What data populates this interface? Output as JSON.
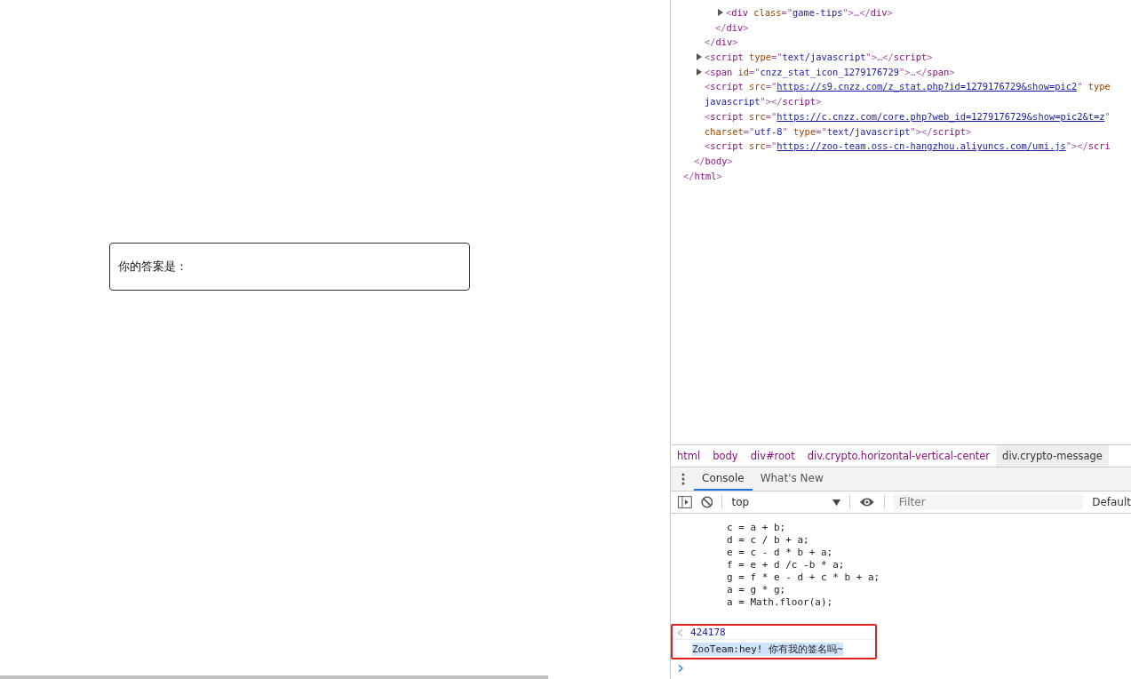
{
  "page": {
    "answer_label": "你的答案是："
  },
  "elements": {
    "tree": [
      {
        "children": [
          {
            "children": [
              {
                "children": [
                  {
                    "children": [
                      {
                        "arrow": true,
                        "lines": [
                          [
                            {
                              "kind": "punct",
                              "s": "<"
                            },
                            {
                              "kind": "tag",
                              "s": "div "
                            },
                            {
                              "kind": "attr",
                              "s": "class"
                            },
                            {
                              "kind": "punct",
                              "s": "=\""
                            },
                            {
                              "kind": "value",
                              "s": "game-tips"
                            },
                            {
                              "kind": "punct",
                              "s": "\">…</"
                            },
                            {
                              "kind": "tag",
                              "s": "div"
                            },
                            {
                              "kind": "punct",
                              "s": ">"
                            }
                          ]
                        ]
                      }
                    ],
                    "close": [
                      {
                        "kind": "punct",
                        "s": "</"
                      },
                      {
                        "kind": "tag",
                        "s": "div"
                      },
                      {
                        "kind": "punct",
                        "s": ">"
                      }
                    ]
                  }
                ],
                "close": [
                  {
                    "kind": "punct",
                    "s": "</"
                  },
                  {
                    "kind": "tag",
                    "s": "div"
                  },
                  {
                    "kind": "punct",
                    "s": ">"
                  }
                ]
              },
              {
                "arrow": true,
                "lines": [
                  [
                    {
                      "kind": "punct",
                      "s": "<"
                    },
                    {
                      "kind": "tag",
                      "s": "script "
                    },
                    {
                      "kind": "attr",
                      "s": "type"
                    },
                    {
                      "kind": "punct",
                      "s": "=\""
                    },
                    {
                      "kind": "value",
                      "s": "text/javascript"
                    },
                    {
                      "kind": "punct",
                      "s": "\">…</"
                    },
                    {
                      "kind": "tag",
                      "s": "script"
                    },
                    {
                      "kind": "punct",
                      "s": ">"
                    }
                  ]
                ]
              },
              {
                "arrow": true,
                "lines": [
                  [
                    {
                      "kind": "punct",
                      "s": "<"
                    },
                    {
                      "kind": "tag",
                      "s": "span "
                    },
                    {
                      "kind": "attr",
                      "s": "id"
                    },
                    {
                      "kind": "punct",
                      "s": "=\""
                    },
                    {
                      "kind": "value",
                      "s": "cnzz_stat_icon_1279176729"
                    },
                    {
                      "kind": "punct",
                      "s": "\">…</"
                    },
                    {
                      "kind": "tag",
                      "s": "span"
                    },
                    {
                      "kind": "punct",
                      "s": ">"
                    }
                  ]
                ]
              },
              {
                "arrow": false,
                "lines": [
                  [
                    {
                      "kind": "punct",
                      "s": "<"
                    },
                    {
                      "kind": "tag",
                      "s": "script "
                    },
                    {
                      "kind": "attr",
                      "s": "src"
                    },
                    {
                      "kind": "punct",
                      "s": "=\""
                    },
                    {
                      "kind": "link",
                      "s": "https://s9.cnzz.com/z_stat.php?id=1279176729&show=pic2"
                    },
                    {
                      "kind": "punct",
                      "s": "\" "
                    },
                    {
                      "kind": "attr",
                      "s": "type"
                    }
                  ],
                  [
                    {
                      "kind": "value",
                      "s": "javascript"
                    },
                    {
                      "kind": "punct",
                      "s": "\"></"
                    },
                    {
                      "kind": "tag",
                      "s": "script"
                    },
                    {
                      "kind": "punct",
                      "s": ">"
                    }
                  ]
                ]
              },
              {
                "arrow": false,
                "lines": [
                  [
                    {
                      "kind": "punct",
                      "s": "<"
                    },
                    {
                      "kind": "tag",
                      "s": "script "
                    },
                    {
                      "kind": "attr",
                      "s": "src"
                    },
                    {
                      "kind": "punct",
                      "s": "=\""
                    },
                    {
                      "kind": "link",
                      "s": "https://c.cnzz.com/core.php?web_id=1279176729&show=pic2&t=z"
                    },
                    {
                      "kind": "punct",
                      "s": "\""
                    }
                  ],
                  [
                    {
                      "kind": "attr",
                      "s": "charset"
                    },
                    {
                      "kind": "punct",
                      "s": "=\""
                    },
                    {
                      "kind": "value",
                      "s": "utf-8"
                    },
                    {
                      "kind": "punct",
                      "s": "\" "
                    },
                    {
                      "kind": "attr",
                      "s": "type"
                    },
                    {
                      "kind": "punct",
                      "s": "=\""
                    },
                    {
                      "kind": "value",
                      "s": "text/javascript"
                    },
                    {
                      "kind": "punct",
                      "s": "\"></"
                    },
                    {
                      "kind": "tag",
                      "s": "script"
                    },
                    {
                      "kind": "punct",
                      "s": ">"
                    }
                  ]
                ]
              },
              {
                "arrow": false,
                "lines": [
                  [
                    {
                      "kind": "punct",
                      "s": "<"
                    },
                    {
                      "kind": "tag",
                      "s": "script "
                    },
                    {
                      "kind": "attr",
                      "s": "src"
                    },
                    {
                      "kind": "punct",
                      "s": "=\""
                    },
                    {
                      "kind": "link",
                      "s": "https://zoo-team.oss-cn-hangzhou.aliyuncs.com/umi.js"
                    },
                    {
                      "kind": "punct",
                      "s": "\"></"
                    },
                    {
                      "kind": "tag",
                      "s": "scri"
                    }
                  ]
                ]
              }
            ],
            "close": [
              {
                "kind": "punct",
                "s": "</"
              },
              {
                "kind": "tag",
                "s": "body"
              },
              {
                "kind": "punct",
                "s": ">"
              }
            ]
          }
        ],
        "close": [
          {
            "kind": "punct",
            "s": "</"
          },
          {
            "kind": "tag",
            "s": "html"
          },
          {
            "kind": "punct",
            "s": ">"
          }
        ]
      }
    ]
  },
  "breadcrumbs": [
    {
      "label": "html",
      "selected": false
    },
    {
      "label": "body",
      "selected": false
    },
    {
      "label": "div#root",
      "selected": false
    },
    {
      "label": "div.crypto.horizontal-vertical-center",
      "selected": false
    },
    {
      "label": "div.crypto-message",
      "selected": true
    }
  ],
  "drawer_tabs": [
    {
      "label": "Console",
      "selected": true
    },
    {
      "label": "What's New",
      "selected": false
    }
  ],
  "console_toolbar": {
    "context": "top",
    "filter_placeholder": "Filter",
    "levels": "Default"
  },
  "console": {
    "code_lines": [
      "c = a + b;",
      "d = c / b + a;",
      "e = c - d * b + a;",
      "f = e + d /c -b * a;",
      "g = f * e - d + c * b + a;",
      "a = g * g;",
      "a = Math.floor(a);"
    ],
    "result": "424178",
    "log": "ZooTeam:hey! 你有我的签名吗~",
    "log_selected": true,
    "highlighted": true
  }
}
